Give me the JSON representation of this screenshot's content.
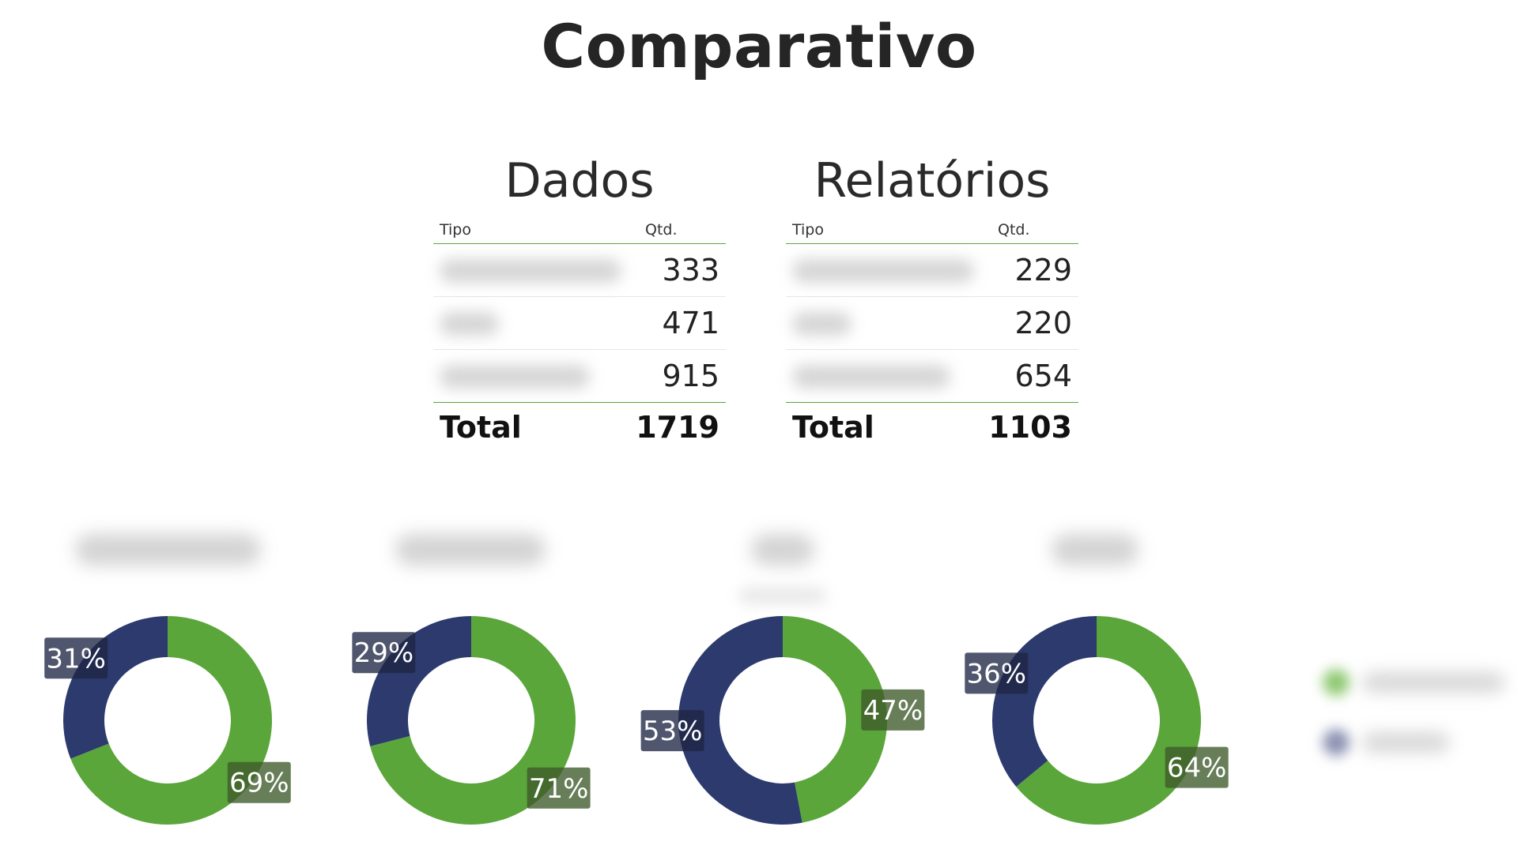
{
  "title": "Comparativo",
  "tables": [
    {
      "title": "Dados",
      "header": {
        "tipo": "Tipo",
        "qtd": "Qtd."
      },
      "rows": [
        {
          "tipo": "",
          "qtd": "333"
        },
        {
          "tipo": "",
          "qtd": "471"
        },
        {
          "tipo": "",
          "qtd": "915"
        }
      ],
      "total_label": "Total",
      "total_value": "1719"
    },
    {
      "title": "Relatórios",
      "header": {
        "tipo": "Tipo",
        "qtd": "Qtd."
      },
      "rows": [
        {
          "tipo": "",
          "qtd": "229"
        },
        {
          "tipo": "",
          "qtd": "220"
        },
        {
          "tipo": "",
          "qtd": "654"
        }
      ],
      "total_label": "Total",
      "total_value": "1103"
    }
  ],
  "colors": {
    "green": "#5aa63a",
    "navy": "#2c3a6e",
    "label_green_bg": "#3d5a2a",
    "label_navy_bg": "#1f2644",
    "label_gray_bg": "#7a7a7a"
  },
  "chart_data": [
    {
      "type": "pie",
      "variant": "donut",
      "title": "",
      "slices": [
        {
          "label": "",
          "value": 69,
          "display": "69%",
          "color": "#5aa63a"
        },
        {
          "label": "",
          "value": 31,
          "display": "31%",
          "color": "#2c3a6e"
        }
      ]
    },
    {
      "type": "pie",
      "variant": "donut",
      "title": "",
      "slices": [
        {
          "label": "",
          "value": 71,
          "display": "71%",
          "color": "#5aa63a"
        },
        {
          "label": "",
          "value": 29,
          "display": "29%",
          "color": "#2c3a6e"
        }
      ]
    },
    {
      "type": "pie",
      "variant": "donut",
      "title": "",
      "slices": [
        {
          "label": "",
          "value": 47,
          "display": "47%",
          "color": "#5aa63a"
        },
        {
          "label": "",
          "value": 53,
          "display": "53%",
          "color": "#2c3a6e"
        }
      ]
    },
    {
      "type": "pie",
      "variant": "donut",
      "title": "",
      "slices": [
        {
          "label": "",
          "value": 64,
          "display": "64%",
          "color": "#5aa63a"
        },
        {
          "label": "",
          "value": 36,
          "display": "36%",
          "color": "#2c3a6e"
        }
      ]
    }
  ]
}
